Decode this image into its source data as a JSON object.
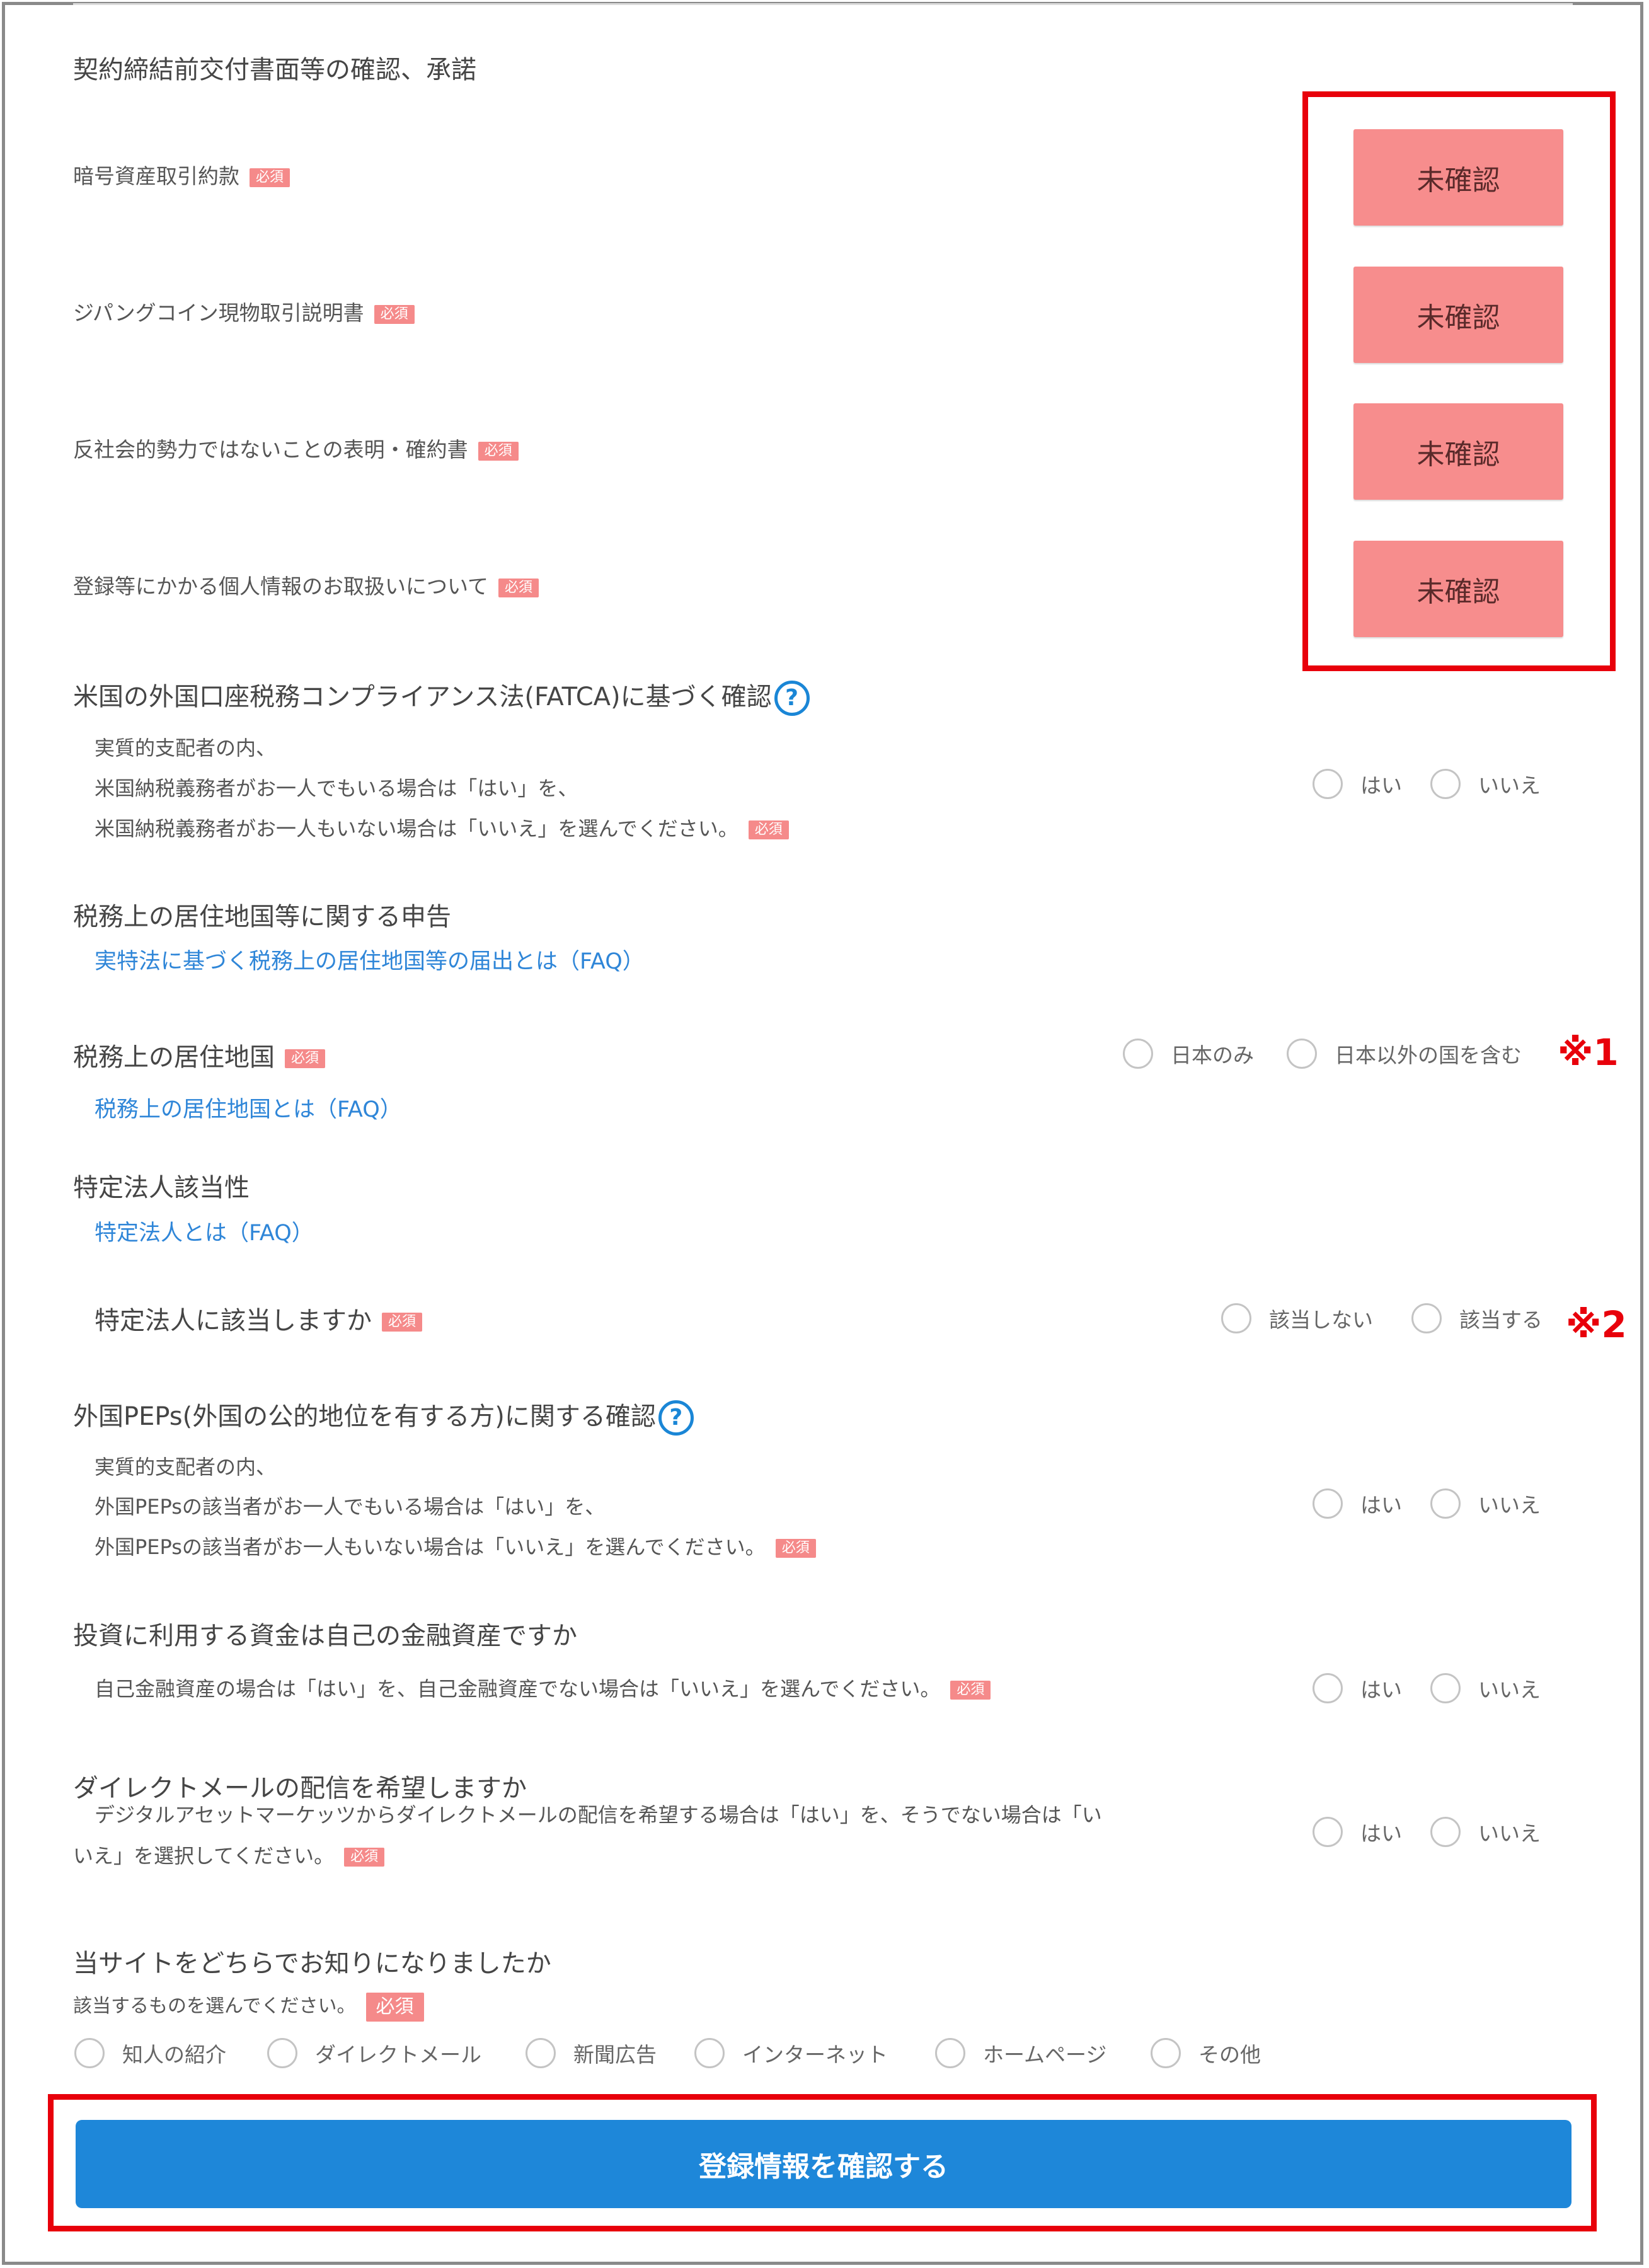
{
  "contract": {
    "title": "契約締結前交付書面等の確認、承諾",
    "required": "必須",
    "docs": [
      {
        "label": "暗号資産取引約款",
        "button": "未確認"
      },
      {
        "label": "ジパングコイン現物取引説明書",
        "button": "未確認"
      },
      {
        "label": "反社会的勢力ではないことの表明・確約書",
        "button": "未確認"
      },
      {
        "label": "登録等にかかる個人情報のお取扱いについて",
        "button": "未確認"
      }
    ]
  },
  "fatca": {
    "title": "米国の外国口座税務コンプライアンス法(FATCA)に基づく確認",
    "help": "?",
    "desc1": "実質的支配者の内、",
    "desc2": "米国納税義務者がお一人でもいる場合は「はい」を、",
    "desc3": "米国納税義務者がお一人もいない場合は「いいえ」を選んでください。",
    "yes": "はい",
    "no": "いいえ"
  },
  "tax": {
    "title": "税務上の居住地国等に関する申告",
    "link": "実特法に基づく税務上の居住地国等の届出とは（FAQ）",
    "residence_label": "税務上の居住地国",
    "residence_link": "税務上の居住地国とは（FAQ）",
    "opt1": "日本のみ",
    "opt2": "日本以外の国を含む",
    "note": "※1"
  },
  "corp": {
    "title": "特定法人該当性",
    "link": "特定法人とは（FAQ）",
    "question": "特定法人に該当しますか",
    "opt1": "該当しない",
    "opt2": "該当する",
    "note": "※2"
  },
  "peps": {
    "title": "外国PEPs(外国の公的地位を有する方)に関する確認",
    "help": "?",
    "desc1": "実質的支配者の内、",
    "desc2": "外国PEPsの該当者がお一人でもいる場合は「はい」を、",
    "desc3": "外国PEPsの該当者がお一人もいない場合は「いいえ」を選んでください。",
    "yes": "はい",
    "no": "いいえ"
  },
  "funds": {
    "title": "投資に利用する資金は自己の金融資産ですか",
    "desc": "自己金融資産の場合は「はい」を、自己金融資産でない場合は「いいえ」を選んでください。",
    "yes": "はい",
    "no": "いいえ"
  },
  "dm": {
    "title": "ダイレクトメールの配信を希望しますか",
    "desc1": "デジタルアセットマーケッツからダイレクトメールの配信を希望する場合は「はい」を、そうでない場合は「い",
    "desc2": "いえ」を選択してください。",
    "yes": "はい",
    "no": "いいえ"
  },
  "source": {
    "title": "当サイトをどちらでお知りになりましたか",
    "desc": "該当するものを選んでください。",
    "options": [
      "知人の紹介",
      "ダイレクトメール",
      "新聞広告",
      "インターネット",
      "ホームページ",
      "その他"
    ]
  },
  "submit": "登録情報を確認する"
}
